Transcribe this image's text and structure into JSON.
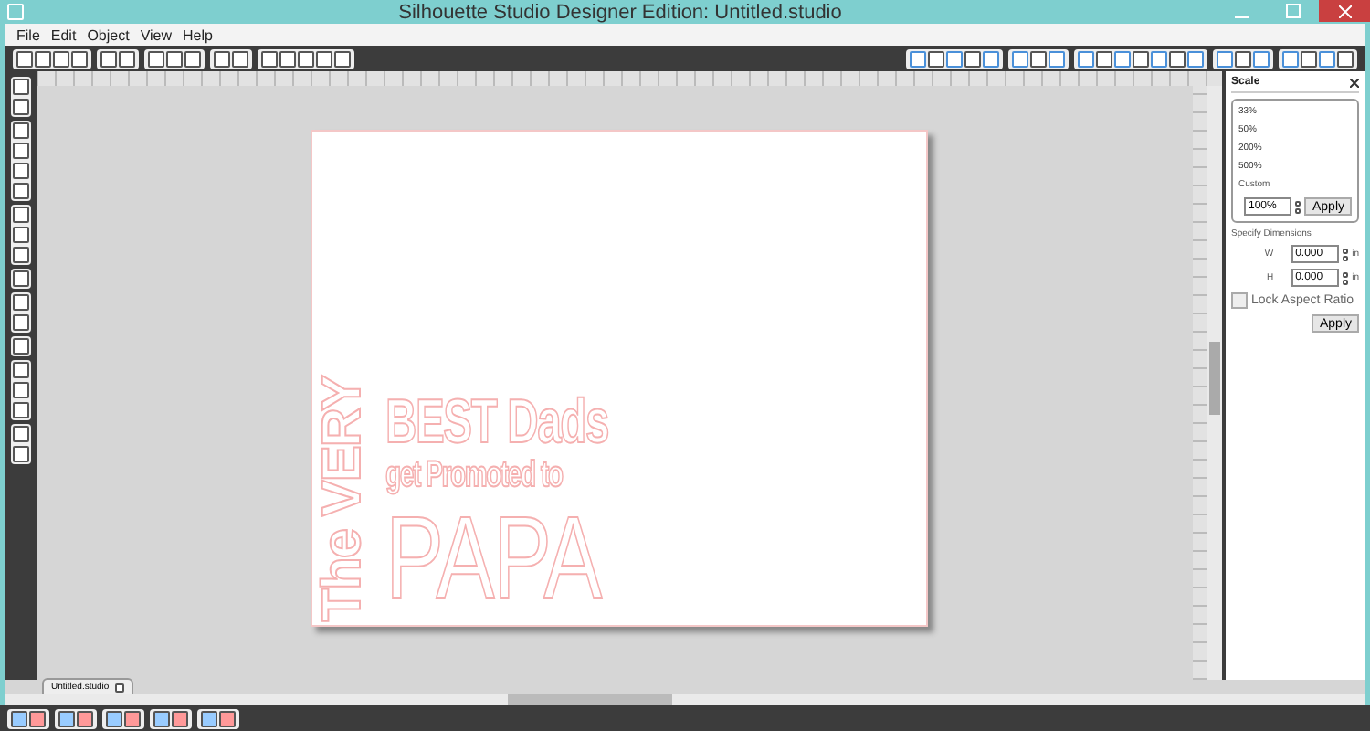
{
  "window": {
    "title": "Silhouette Studio Designer Edition: Untitled.studio"
  },
  "menu": [
    "File",
    "Edit",
    "Object",
    "View",
    "Help"
  ],
  "design": {
    "vertical_text": "The VERY",
    "lines": [
      {
        "text": "BEST Dads",
        "kind": "large"
      },
      {
        "text": "get Promoted to",
        "kind": "medium"
      },
      {
        "text": "PAPA",
        "kind": "huge"
      }
    ]
  },
  "panel": {
    "title": "Scale",
    "presets": [
      {
        "label": "33%",
        "selected": false
      },
      {
        "label": "50%",
        "selected": false
      },
      {
        "label": "200%",
        "selected": false
      },
      {
        "label": "500%",
        "selected": false
      }
    ],
    "custom_label": "Custom",
    "custom_value": "100%",
    "apply": "Apply",
    "dimensions_title": "Specify Dimensions",
    "fields": [
      {
        "label": "W",
        "value": "0.000",
        "unit": "in"
      },
      {
        "label": "H",
        "value": "0.000",
        "unit": "in"
      }
    ],
    "lock": {
      "label": "Lock Aspect Ratio",
      "checked": false
    },
    "apply_dimensions": "Apply"
  },
  "document_tab": {
    "label": "Untitled.studio"
  }
}
